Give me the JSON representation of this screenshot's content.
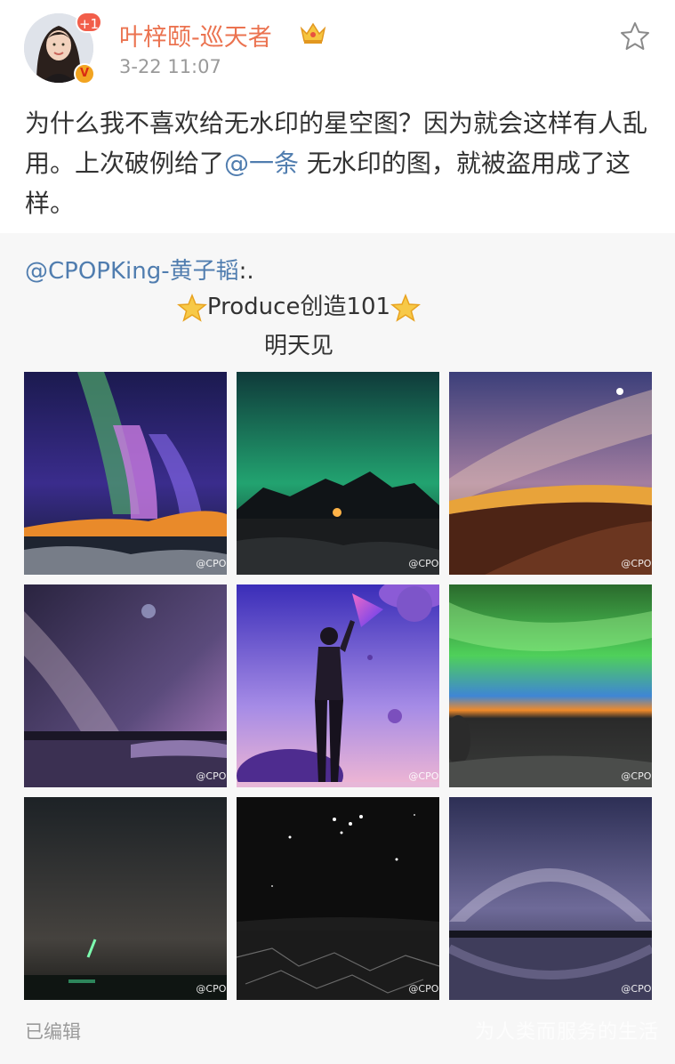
{
  "post": {
    "avatar_badge": "+1",
    "verified_badge": "V",
    "username": "叶梓颐-巡天者",
    "timestamp": "3-22 11:07",
    "text_part1": "为什么我不喜欢给无水印的星空图？因为就会这样有人乱用。上次破例给了",
    "mention": "@一条",
    "text_part2": " 无水印的图，就被盗用成了这样。"
  },
  "repost": {
    "author_mention": "@CPOPKing-黄子韬",
    "author_suffix": ":.",
    "line2_text": "Produce创造101",
    "line3_text": "明天见",
    "images": [
      {
        "watermark": "@CPOP",
        "icon": "aurora-photo"
      },
      {
        "watermark": "@CPOP",
        "icon": "green-aurora-mountain-photo"
      },
      {
        "watermark": "@CPOP",
        "icon": "milky-way-desert-photo"
      },
      {
        "watermark": "@CPOP",
        "icon": "milky-way-reflection-photo"
      },
      {
        "watermark": "@CPOP",
        "icon": "person-planets-illustration"
      },
      {
        "watermark": "@CPOP",
        "icon": "green-aurora-horizon-photo"
      },
      {
        "watermark": "@CPOP",
        "icon": "meteor-photo"
      },
      {
        "watermark": "@CPOP",
        "icon": "constellation-salt-flat-photo"
      },
      {
        "watermark": "@CPOP",
        "icon": "milky-way-arch-photo"
      }
    ],
    "edited_label": "已编辑"
  },
  "corner_watermark": "为人类而服务的生活",
  "colors": {
    "username": "#eb7350",
    "mention": "#507daf",
    "timestamp": "#9a9a9a",
    "repost_bg": "#f7f7f7"
  }
}
